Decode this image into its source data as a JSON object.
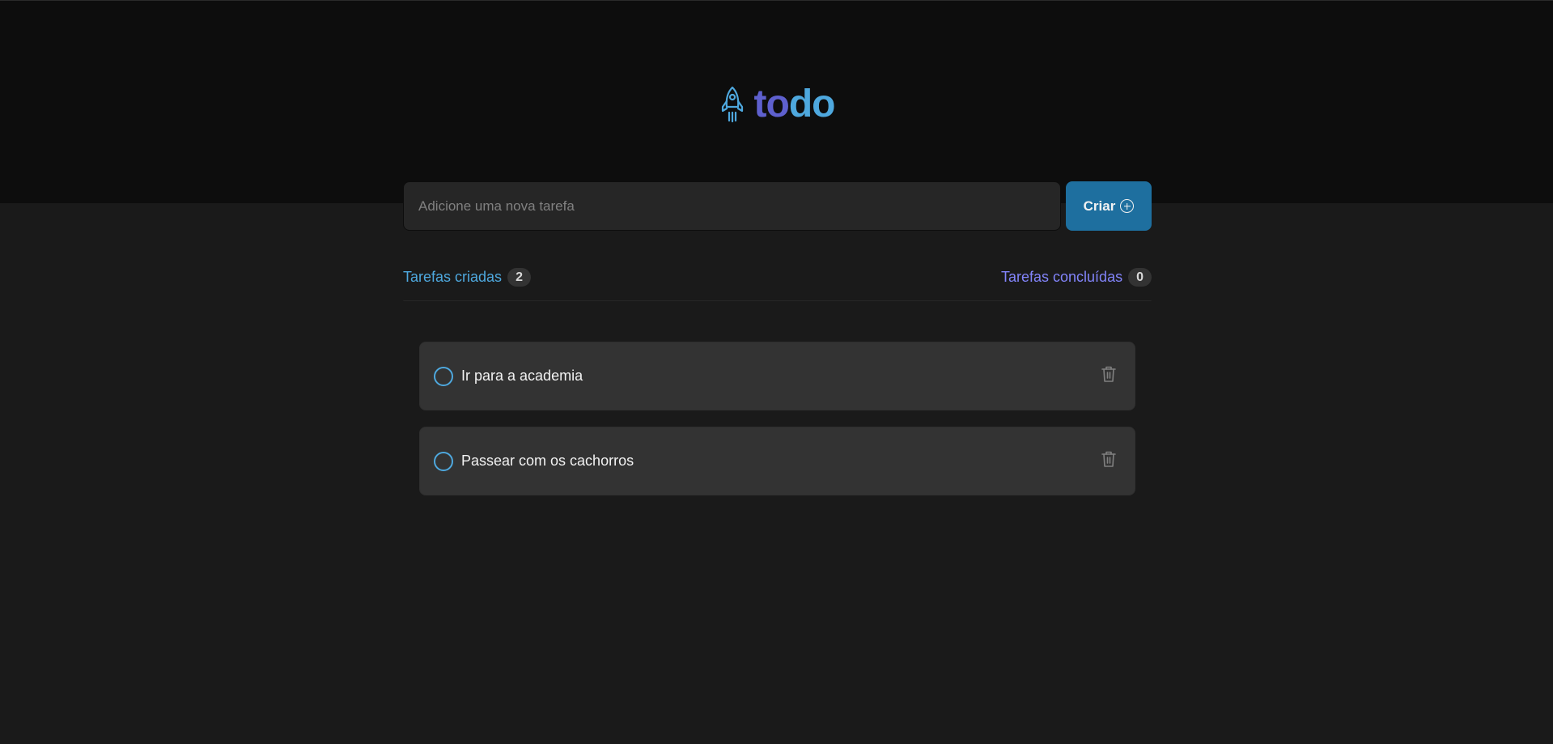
{
  "header": {
    "logo": {
      "part1": "to",
      "part2": "do",
      "icon": "rocket-icon"
    }
  },
  "form": {
    "placeholder": "Adicione uma nova tarefa",
    "value": "",
    "create_label": "Criar",
    "create_icon": "plus-circle-icon"
  },
  "stats": {
    "created_label": "Tarefas criadas",
    "created_count": "2",
    "done_label": "Tarefas concluídas",
    "done_count": "0"
  },
  "tasks": [
    {
      "text": "Ir para a academia",
      "done": false
    },
    {
      "text": "Passear com os cachorros",
      "done": false
    }
  ],
  "colors": {
    "blue": "#4ea8de",
    "purple": "#5e60ce",
    "purple_light": "#8284fa",
    "button": "#1e6f9f",
    "header_bg": "#0d0d0d",
    "page_bg": "#1a1a1a",
    "card_bg": "#333333"
  }
}
